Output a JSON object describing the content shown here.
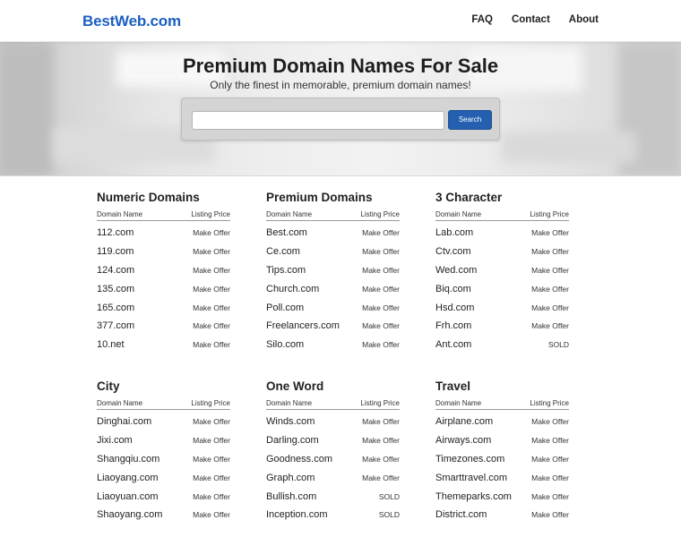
{
  "site": {
    "logo": "BestWeb.com"
  },
  "nav": [
    "FAQ",
    "Contact",
    "About"
  ],
  "hero": {
    "title": "Premium Domain Names For Sale",
    "subtitle": "Only the finest in memorable, premium domain names!",
    "search_placeholder": "",
    "search_button": "Search"
  },
  "table_headers": {
    "name": "Domain Name",
    "price": "Listing Price"
  },
  "categories": [
    {
      "title": "Numeric Domains",
      "rows": [
        {
          "name": "112.com",
          "price": "Make Offer"
        },
        {
          "name": "119.com",
          "price": "Make Offer"
        },
        {
          "name": "124.com",
          "price": "Make Offer"
        },
        {
          "name": "135.com",
          "price": "Make Offer"
        },
        {
          "name": "165.com",
          "price": "Make Offer"
        },
        {
          "name": "377.com",
          "price": "Make Offer"
        },
        {
          "name": "10.net",
          "price": "Make Offer"
        }
      ]
    },
    {
      "title": "Premium Domains",
      "rows": [
        {
          "name": "Best.com",
          "price": "Make Offer"
        },
        {
          "name": "Ce.com",
          "price": "Make Offer"
        },
        {
          "name": "Tips.com",
          "price": "Make Offer"
        },
        {
          "name": "Church.com",
          "price": "Make Offer"
        },
        {
          "name": "Poll.com",
          "price": "Make Offer"
        },
        {
          "name": "Freelancers.com",
          "price": "Make Offer"
        },
        {
          "name": "Silo.com",
          "price": "Make Offer"
        }
      ]
    },
    {
      "title": "3 Character",
      "rows": [
        {
          "name": "Lab.com",
          "price": "Make Offer"
        },
        {
          "name": "Ctv.com",
          "price": "Make Offer"
        },
        {
          "name": "Wed.com",
          "price": "Make Offer"
        },
        {
          "name": "Biq.com",
          "price": "Make Offer"
        },
        {
          "name": "Hsd.com",
          "price": "Make Offer"
        },
        {
          "name": "Frh.com",
          "price": "Make Offer"
        },
        {
          "name": "Ant.com",
          "price": "SOLD"
        }
      ]
    },
    {
      "title": "City",
      "rows": [
        {
          "name": "Dinghai.com",
          "price": "Make Offer"
        },
        {
          "name": "Jixi.com",
          "price": "Make Offer"
        },
        {
          "name": "Shangqiu.com",
          "price": "Make Offer"
        },
        {
          "name": "Liaoyang.com",
          "price": "Make Offer"
        },
        {
          "name": "Liaoyuan.com",
          "price": "Make Offer"
        },
        {
          "name": "Shaoyang.com",
          "price": "Make Offer"
        }
      ]
    },
    {
      "title": "One Word",
      "rows": [
        {
          "name": "Winds.com",
          "price": "Make Offer"
        },
        {
          "name": "Darling.com",
          "price": "Make Offer"
        },
        {
          "name": "Goodness.com",
          "price": "Make Offer"
        },
        {
          "name": "Graph.com",
          "price": "Make Offer"
        },
        {
          "name": "Bullish.com",
          "price": "SOLD"
        },
        {
          "name": "Inception.com",
          "price": "SOLD"
        }
      ]
    },
    {
      "title": "Travel",
      "rows": [
        {
          "name": "Airplane.com",
          "price": "Make Offer"
        },
        {
          "name": "Airways.com",
          "price": "Make Offer"
        },
        {
          "name": "Timezones.com",
          "price": "Make Offer"
        },
        {
          "name": "Smarttravel.com",
          "price": "Make Offer"
        },
        {
          "name": "Themeparks.com",
          "price": "Make Offer"
        },
        {
          "name": "District.com",
          "price": "Make Offer"
        }
      ]
    }
  ]
}
